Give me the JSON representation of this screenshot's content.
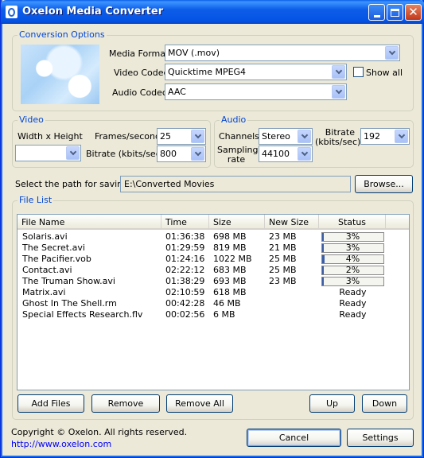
{
  "window": {
    "title": "Oxelon Media Converter"
  },
  "conversion": {
    "group_title": "Conversion Options",
    "media_format_label": "Media Format",
    "media_format_value": "MOV (.mov)",
    "video_codec_label": "Video Codec",
    "video_codec_value": "Quicktime MPEG4",
    "show_all_label": "Show all",
    "show_all_checked": false,
    "audio_codec_label": "Audio Codec",
    "audio_codec_value": "AAC"
  },
  "video": {
    "group_title": "Video",
    "size_label": "Width x Height",
    "size_value": "",
    "fps_label": "Frames/second",
    "fps_value": "25",
    "bitrate_label": "Bitrate (kbits/sec)",
    "bitrate_value": "800"
  },
  "audio": {
    "group_title": "Audio",
    "channels_label": "Channels",
    "channels_value": "Stereo",
    "bitrate_label_1": "Bitrate",
    "bitrate_label_2": "(kbits/sec)",
    "bitrate_value": "192",
    "sampling_label_1": "Sampling",
    "sampling_label_2": "rate",
    "sampling_value": "44100"
  },
  "save_path": {
    "label": "Select the path for saving:",
    "value": "E:\\Converted Movies",
    "browse_label": "Browse..."
  },
  "file_list": {
    "group_title": "File List",
    "columns": [
      "File Name",
      "Time",
      "Size",
      "New Size",
      "Status"
    ],
    "rows": [
      {
        "name": "Solaris.avi",
        "time": "01:36:38",
        "size": "698 MB",
        "new_size": "23 MB",
        "status": "3%",
        "progress": 0.03
      },
      {
        "name": "The Secret.avi",
        "time": "01:29:59",
        "size": "819 MB",
        "new_size": "21 MB",
        "status": "3%",
        "progress": 0.03
      },
      {
        "name": "The Pacifier.vob",
        "time": "01:24:16",
        "size": "1022 MB",
        "new_size": "25 MB",
        "status": "4%",
        "progress": 0.04
      },
      {
        "name": "Contact.avi",
        "time": "02:22:12",
        "size": "683 MB",
        "new_size": "25 MB",
        "status": "2%",
        "progress": 0.02
      },
      {
        "name": "The Truman Show.avi",
        "time": "01:38:29",
        "size": "693 MB",
        "new_size": "23 MB",
        "status": "3%",
        "progress": 0.03
      },
      {
        "name": "Matrix.avi",
        "time": "02:10:59",
        "size": "618 MB",
        "new_size": "",
        "status": "Ready",
        "progress": null
      },
      {
        "name": "Ghost In The Shell.rm",
        "time": "00:42:28",
        "size": "46 MB",
        "new_size": "",
        "status": "Ready",
        "progress": null
      },
      {
        "name": "Special Effects Research.flv",
        "time": "00:02:56",
        "size": "6 MB",
        "new_size": "",
        "status": "Ready",
        "progress": null
      }
    ],
    "add_files_label": "Add Files",
    "remove_label": "Remove",
    "remove_all_label": "Remove All",
    "up_label": "Up",
    "down_label": "Down"
  },
  "footer": {
    "copyright": "Copyright © Oxelon. All rights reserved.",
    "url": "http://www.oxelon.com",
    "cancel_label": "Cancel",
    "settings_label": "Settings"
  },
  "colors": {
    "titlebar": "#0553E3",
    "group_title": "#0046D5",
    "progress_fill": "#3A5DA8",
    "link": "#0000FF"
  }
}
